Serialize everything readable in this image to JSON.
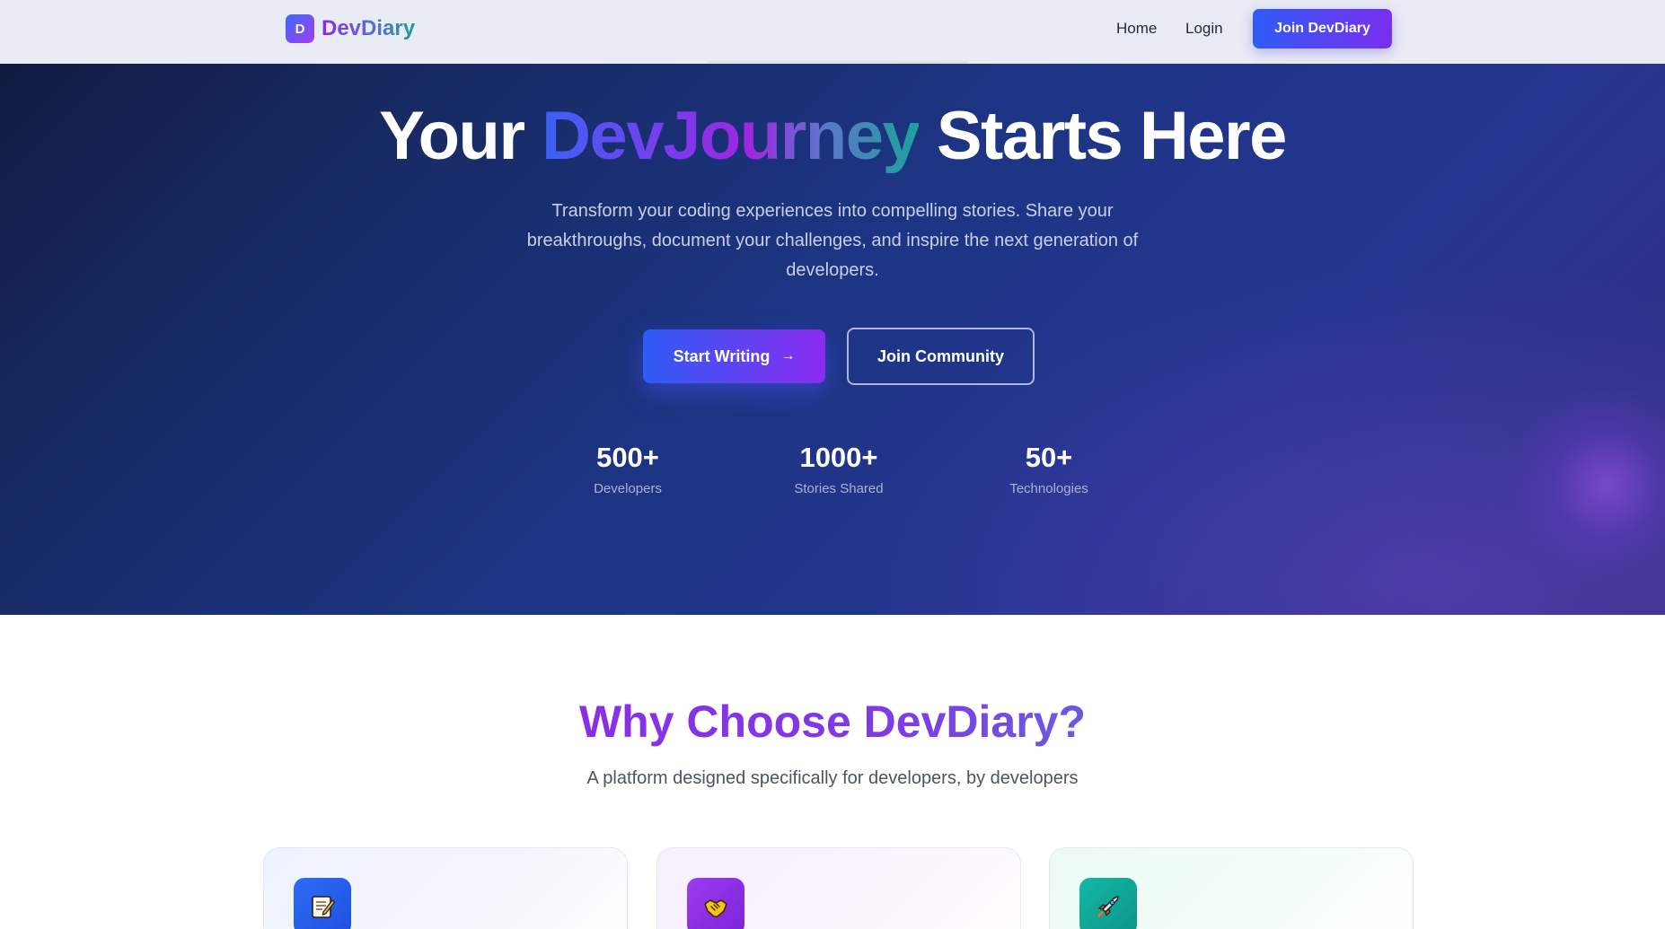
{
  "navbar": {
    "brand_badge": "D",
    "brand_name": "DevDiary",
    "links": [
      {
        "label": "Home"
      },
      {
        "label": "Login"
      }
    ],
    "cta_label": "Join DevDiary"
  },
  "hero": {
    "title_prefix": "Your ",
    "title_accent": "DevJourney",
    "title_suffix": " Starts Here",
    "subtitle": "Transform your coding experiences into compelling stories. Share your breakthroughs, document your challenges, and inspire the next generation of developers.",
    "primary_button": "Start Writing",
    "primary_button_icon": "→",
    "secondary_button": "Join Community",
    "stats": [
      {
        "value": "500+",
        "label": "Developers"
      },
      {
        "value": "1000+",
        "label": "Stories Shared"
      },
      {
        "value": "50+",
        "label": "Technologies"
      }
    ]
  },
  "features": {
    "title": "Why Choose DevDiary?",
    "subtitle": "A platform designed specifically for developers, by developers",
    "cards": [
      {
        "icon_name": "memo-icon",
        "icon_color": "#2f6df6"
      },
      {
        "icon_name": "handshake-icon",
        "icon_color": "#9d3cf0"
      },
      {
        "icon_name": "rocket-icon",
        "icon_color": "#14b8a6"
      }
    ]
  },
  "colors": {
    "accent_blue": "#2f5cf6",
    "accent_purple": "#7a2ef0",
    "accent_teal": "#1aa39a",
    "hero_background": "#1d3585"
  }
}
